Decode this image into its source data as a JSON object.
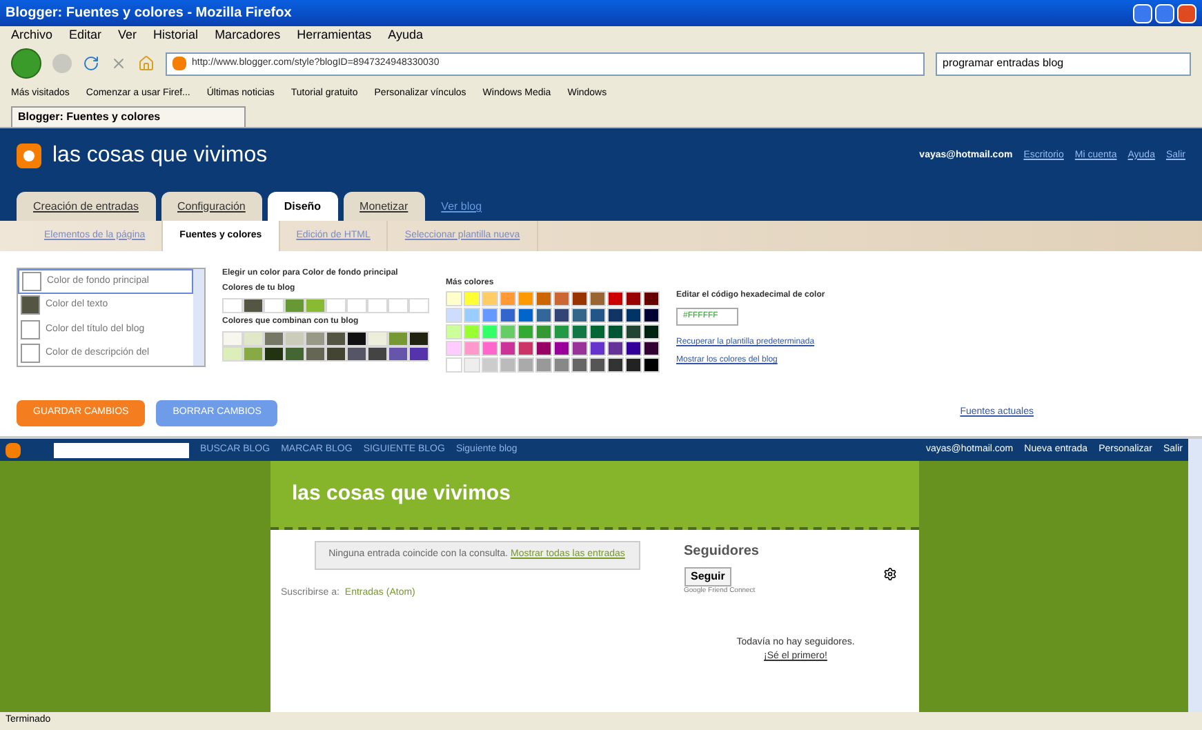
{
  "window": {
    "title": "Blogger: Fuentes y colores - Mozilla Firefox"
  },
  "menu": [
    "Archivo",
    "Editar",
    "Ver",
    "Historial",
    "Marcadores",
    "Herramientas",
    "Ayuda"
  ],
  "address": {
    "value": "http://www.blogger.com/style?blogID=8947324948330030"
  },
  "search": {
    "value": "programar entradas blog"
  },
  "bookmarks": [
    "Más visitados",
    "Comenzar a usar Firef...",
    "Últimas noticias",
    "Tutorial gratuito",
    "Personalizar vínculos",
    "Windows Media",
    "Windows"
  ],
  "browser_tabs": [
    {
      "label": "Blogger: Fuentes y colores",
      "selected": true
    }
  ],
  "header": {
    "blog_title": "las cosas que vivimos",
    "account": "vayas@hotmail.com",
    "links": [
      "Escritorio",
      "Mi cuenta",
      "Ayuda",
      "Salir"
    ]
  },
  "tabs": [
    {
      "label": "Creación de entradas",
      "selected": false
    },
    {
      "label": "Configuración",
      "selected": false
    },
    {
      "label": "Diseño",
      "selected": true
    },
    {
      "label": "Monetizar",
      "selected": false
    }
  ],
  "view_blog": "Ver blog",
  "subtabs": [
    {
      "label": "Elementos de la página",
      "selected": false
    },
    {
      "label": "Fuentes y colores",
      "selected": true
    },
    {
      "label": "Edición de HTML",
      "selected": false
    },
    {
      "label": "Seleccionar plantilla nueva",
      "selected": false
    }
  ],
  "color_targets": [
    {
      "label": "Color de fondo principal",
      "color": "#ffffff",
      "selected": true
    },
    {
      "label": "Color del texto",
      "color": "#555544",
      "selected": false
    },
    {
      "label": "Color del título del blog",
      "color": "#ffffff",
      "selected": false
    },
    {
      "label": "Color de descripción del",
      "color": "#ffffff",
      "selected": false
    }
  ],
  "picker": {
    "heading": "Elegir un color para Color de fondo principal",
    "blog_colors_label": "Colores de tu blog",
    "blog_colors": [
      {
        "color": "#ffffff"
      },
      {
        "color": "#555544"
      },
      {
        "color": "#ffffff"
      },
      {
        "color": "#669933"
      },
      {
        "color": "#88bb33"
      },
      {
        "color": "#ffffff"
      },
      {
        "color": "#ffffff"
      },
      {
        "color": "#ffffff"
      },
      {
        "color": "#ffffff"
      },
      {
        "color": "#ffffff"
      }
    ],
    "matching_label": "Colores que combinan con tu blog",
    "matching_colors": [
      {
        "color": "#f7f7f0"
      },
      {
        "color": "#e0e8c8"
      },
      {
        "color": "#777766"
      },
      {
        "color": "#ccccbb"
      },
      {
        "color": "#999988"
      },
      {
        "color": "#555544"
      },
      {
        "color": "#111111"
      },
      {
        "color": "#eeeedd"
      },
      {
        "color": "#779933"
      },
      {
        "color": "#222211"
      },
      {
        "color": "#ddeebb"
      },
      {
        "color": "#88aa44"
      },
      {
        "color": "#223311"
      },
      {
        "color": "#446633"
      },
      {
        "color": "#666655"
      },
      {
        "color": "#444433"
      },
      {
        "color": "#555566"
      },
      {
        "color": "#444444"
      },
      {
        "color": "#6655aa"
      },
      {
        "color": "#5533aa"
      }
    ],
    "more_label": "Más colores",
    "more_colors": [
      {
        "color": "#ffffcc"
      },
      {
        "color": "#ffff33"
      },
      {
        "color": "#ffcc66"
      },
      {
        "color": "#ff9933"
      },
      {
        "color": "#ff9900"
      },
      {
        "color": "#cc6600"
      },
      {
        "color": "#cc6633"
      },
      {
        "color": "#993300"
      },
      {
        "color": "#996633"
      },
      {
        "color": "#cc0000"
      },
      {
        "color": "#990000"
      },
      {
        "color": "#660000"
      },
      {
        "color": "#ccddff"
      },
      {
        "color": "#99ccff"
      },
      {
        "color": "#6699ff"
      },
      {
        "color": "#3366cc"
      },
      {
        "color": "#0066cc"
      },
      {
        "color": "#336699"
      },
      {
        "color": "#334477"
      },
      {
        "color": "#336688"
      },
      {
        "color": "#225588"
      },
      {
        "color": "#113366"
      },
      {
        "color": "#003366"
      },
      {
        "color": "#000033"
      },
      {
        "color": "#ccff99"
      },
      {
        "color": "#99ff33"
      },
      {
        "color": "#33ff66"
      },
      {
        "color": "#66cc66"
      },
      {
        "color": "#33aa33"
      },
      {
        "color": "#339933"
      },
      {
        "color": "#229944"
      },
      {
        "color": "#117744"
      },
      {
        "color": "#006633"
      },
      {
        "color": "#005533"
      },
      {
        "color": "#224433"
      },
      {
        "color": "#002211"
      },
      {
        "color": "#ffccff"
      },
      {
        "color": "#ff99cc"
      },
      {
        "color": "#ff66cc"
      },
      {
        "color": "#cc3399"
      },
      {
        "color": "#cc3366"
      },
      {
        "color": "#990066"
      },
      {
        "color": "#990099"
      },
      {
        "color": "#993399"
      },
      {
        "color": "#6633cc"
      },
      {
        "color": "#663399"
      },
      {
        "color": "#330099"
      },
      {
        "color": "#330033"
      },
      {
        "color": "#ffffff"
      },
      {
        "color": "#eeeeee"
      },
      {
        "color": "#cccccc"
      },
      {
        "color": "#bbbbbb"
      },
      {
        "color": "#aaaaaa"
      },
      {
        "color": "#999999"
      },
      {
        "color": "#888888"
      },
      {
        "color": "#666666"
      },
      {
        "color": "#555555"
      },
      {
        "color": "#333333"
      },
      {
        "color": "#222222"
      },
      {
        "color": "#000000"
      }
    ],
    "hex_label": "Editar el código hexadecimal de color",
    "hex_value": "#FFFFFF",
    "restore_link": "Recuperar la plantilla predeterminada",
    "show_link": "Mostrar los colores del blog"
  },
  "buttons": {
    "save": "GUARDAR CAMBIOS",
    "clear": "BORRAR CAMBIOS",
    "fonts_link": "Fuentes actuales"
  },
  "navbar": {
    "links": [
      "BUSCAR BLOG",
      "MARCAR BLOG",
      "SIGUIENTE BLOG"
    ],
    "next": "Siguiente blog",
    "account": "vayas@hotmail.com",
    "right_links": [
      "Nueva entrada",
      "Personalizar",
      "Salir"
    ]
  },
  "blog": {
    "title": "las cosas que vivimos",
    "notice": "Ninguna entrada coincide con la consulta.",
    "show_all": "Mostrar todas las entradas",
    "subscribe": "Suscribirse a:",
    "feed": "Entradas (Atom)",
    "followers": {
      "heading": "Seguidores",
      "follow": "Seguir",
      "gfc": "Google Friend Connect",
      "none": "Todavía no hay seguidores.",
      "first": "¡Sé el primero!"
    }
  },
  "status_bar": "Terminado"
}
